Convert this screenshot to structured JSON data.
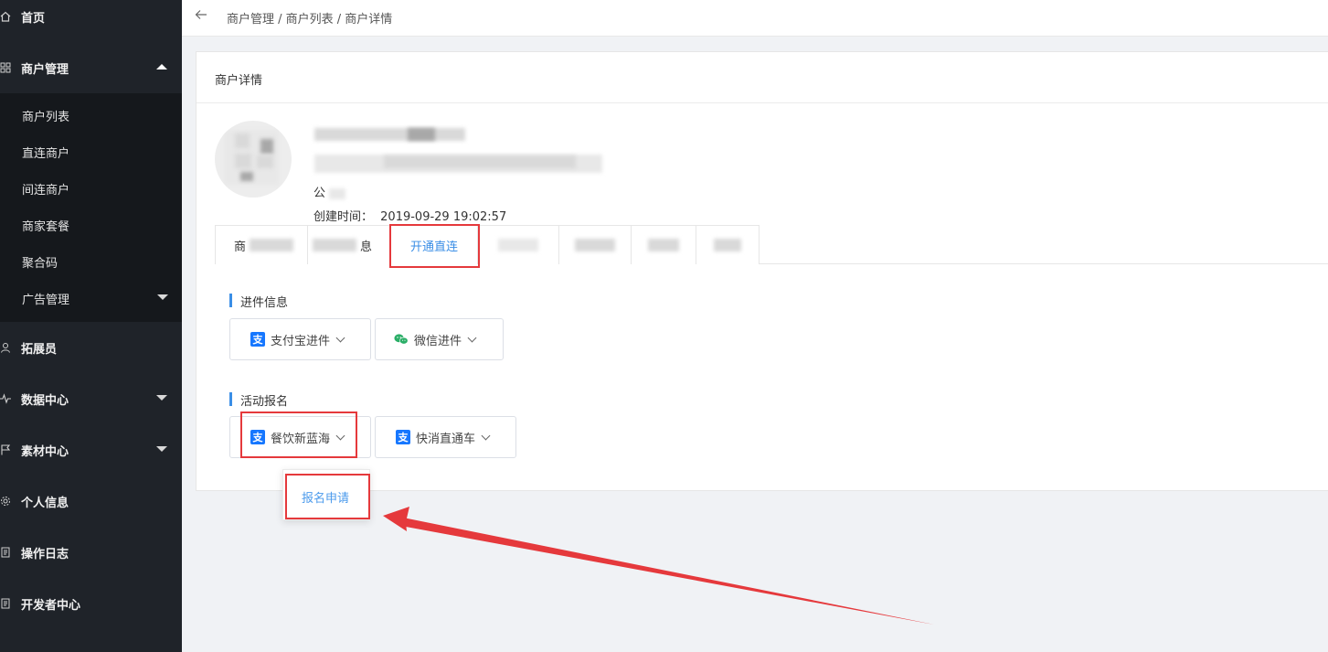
{
  "sidebar": {
    "items": [
      {
        "label": "首页",
        "icon": "home-icon"
      },
      {
        "label": "商户管理",
        "icon": "grid-icon"
      },
      {
        "label": "拓展员",
        "icon": "user-icon"
      },
      {
        "label": "数据中心",
        "icon": "activity-icon"
      },
      {
        "label": "素材中心",
        "icon": "flag-icon"
      },
      {
        "label": "个人信息",
        "icon": "gear-icon"
      },
      {
        "label": "操作日志",
        "icon": "document-icon"
      },
      {
        "label": "开发者中心",
        "icon": "document-icon"
      }
    ],
    "submenu": [
      {
        "label": "商户列表"
      },
      {
        "label": "直连商户"
      },
      {
        "label": "间连商户"
      },
      {
        "label": "商家套餐"
      },
      {
        "label": "聚合码"
      },
      {
        "label": "广告管理"
      }
    ]
  },
  "topbar": {
    "back_icon": "arrow-left-icon",
    "breadcrumb": "商户管理 / 商户列表 / 商户详情"
  },
  "card": {
    "title": "商户详情",
    "company_prefix": "公",
    "created_label": "创建时间：",
    "created_value": "2019-09-29 19:02:57"
  },
  "tabs": [
    {
      "label": "商"
    },
    {
      "label": "息"
    },
    {
      "label": "开通直连"
    }
  ],
  "sections": {
    "onboarding": {
      "title": "进件信息",
      "buttons": [
        {
          "label": "支付宝进件",
          "icon": "alipay-icon"
        },
        {
          "label": "微信进件",
          "icon": "wechat-icon"
        }
      ]
    },
    "activity": {
      "title": "活动报名",
      "buttons": [
        {
          "label": "餐饮新蓝海",
          "icon": "alipay-icon"
        },
        {
          "label": "快消直通车",
          "icon": "alipay-icon"
        }
      ]
    }
  },
  "popup": {
    "item": "报名申请"
  },
  "colors": {
    "sidebar_bg": "#1f2329",
    "accent": "#3a8ee6",
    "annotation": "#e5393c",
    "alipay": "#1677ff",
    "wechat": "#2aae67"
  }
}
